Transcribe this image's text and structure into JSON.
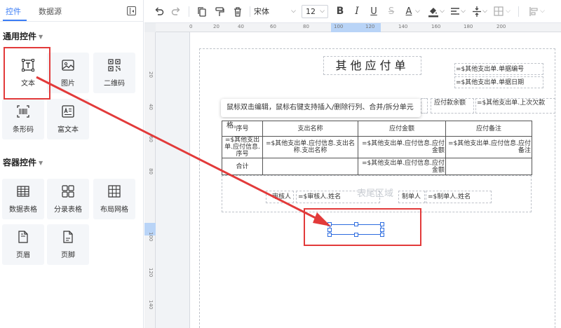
{
  "panel": {
    "tabs": [
      {
        "label": "控件",
        "active": true
      },
      {
        "label": "数据源",
        "active": false
      }
    ],
    "sections": [
      {
        "title": "通用控件",
        "items": [
          {
            "label": "文本",
            "icon": "text-icon"
          },
          {
            "label": "图片",
            "icon": "image-icon"
          },
          {
            "label": "二维码",
            "icon": "qrcode-icon"
          },
          {
            "label": "条形码",
            "icon": "barcode-icon"
          },
          {
            "label": "富文本",
            "icon": "rich-text-icon"
          }
        ]
      },
      {
        "title": "容器控件",
        "items": [
          {
            "label": "数据表格",
            "icon": "data-table-icon"
          },
          {
            "label": "分录表格",
            "icon": "group-table-icon"
          },
          {
            "label": "布局网格",
            "icon": "layout-grid-icon"
          },
          {
            "label": "页眉",
            "icon": "page-header-icon"
          },
          {
            "label": "页脚",
            "icon": "page-footer-icon"
          }
        ]
      }
    ]
  },
  "toolbar": {
    "font": "宋体",
    "size": "12",
    "bold": "B",
    "italic": "I",
    "underline": "U",
    "strike": "S",
    "font_color": "A"
  },
  "ruler": {
    "top": [
      "20",
      "40",
      "60",
      "80",
      "100",
      "120",
      "140",
      "160",
      "180",
      "200"
    ],
    "left": [
      "20",
      "40",
      "60",
      "80",
      "100",
      "120",
      "140"
    ]
  },
  "report": {
    "title": "其他应付单",
    "bill_no": "=$其他支出单.单据编号",
    "bill_date": "=$其他支出单.单据日期",
    "payable_balance_label": "应付款余额",
    "payable_balance_value": "=$其他支出单.上次欠款",
    "tooltip": "鼠标双击编辑，鼠标右键支持插入/删除行列、合并/拆分单元格。",
    "table": {
      "headers": [
        "序号",
        "支出名称",
        "应付金额",
        "应付备注"
      ],
      "row": [
        "=$其他支出单.应付信息.序号",
        "=$其他支出单.应付信息.支出名称.支出名称",
        "=$其他支出单.应付信息.应付金额",
        "=$其他支出单.应付信息.应付备注"
      ],
      "total": [
        "合计",
        "",
        "=$其他支出单.应付信息.应付金额",
        ""
      ]
    },
    "footer_area_label": "表尾区域",
    "reviewer_label": "审核人",
    "reviewer_value": "=$审核人.姓名",
    "maker_label": "制单人",
    "maker_value": "=$制单人.姓名"
  },
  "colors": {
    "accent": "#3a7cf5",
    "highlight": "#e23a3a",
    "selection": "#2d6cdf"
  }
}
